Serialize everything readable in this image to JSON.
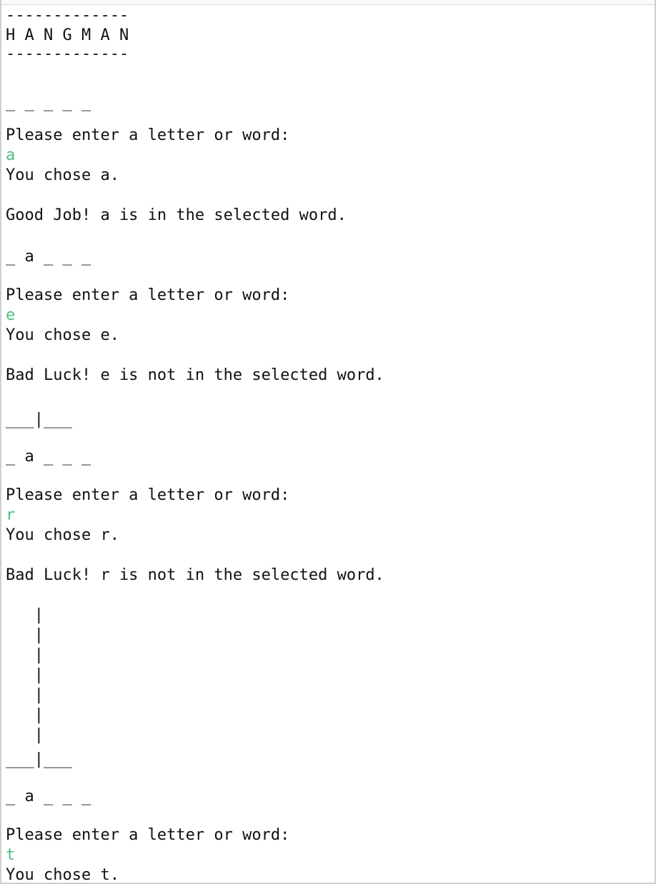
{
  "colors": {
    "text": "#111111",
    "input_echo": "#4fbf7f",
    "background": "#ffffff",
    "frame": "#cfcfcf"
  },
  "console": {
    "lines": [
      {
        "kind": "rule",
        "text": "-------------"
      },
      {
        "kind": "title",
        "text": "H A N G M A N"
      },
      {
        "kind": "rule",
        "text": "-------------"
      },
      {
        "kind": "blanks",
        "text": "_ _ _ _ _"
      },
      {
        "kind": "prompt",
        "text": "Please enter a letter or word:"
      },
      {
        "kind": "input",
        "text": "a"
      },
      {
        "kind": "message",
        "text": "You chose a."
      },
      {
        "kind": "message",
        "text": "Good Job! a is in the selected word."
      },
      {
        "kind": "blanks",
        "text": "_ a _ _ _"
      },
      {
        "kind": "prompt",
        "text": "Please enter a letter or word:"
      },
      {
        "kind": "input",
        "text": "e"
      },
      {
        "kind": "message",
        "text": "You chose e."
      },
      {
        "kind": "message",
        "text": "Bad Luck! e is not in the selected word."
      },
      {
        "kind": "art",
        "text": "___|___"
      },
      {
        "kind": "blanks",
        "text": "_ a _ _ _"
      },
      {
        "kind": "prompt",
        "text": "Please enter a letter or word:"
      },
      {
        "kind": "input",
        "text": "r"
      },
      {
        "kind": "message",
        "text": "You chose r."
      },
      {
        "kind": "message",
        "text": "Bad Luck! r is not in the selected word."
      },
      {
        "kind": "art",
        "text": "   |"
      },
      {
        "kind": "art",
        "text": "   |"
      },
      {
        "kind": "art",
        "text": "   |"
      },
      {
        "kind": "art",
        "text": "   |"
      },
      {
        "kind": "art",
        "text": "   |"
      },
      {
        "kind": "art",
        "text": "   |"
      },
      {
        "kind": "art",
        "text": "   |"
      },
      {
        "kind": "art",
        "text": "___|___"
      },
      {
        "kind": "blanks",
        "text": "_ a _ _ _"
      },
      {
        "kind": "prompt",
        "text": "Please enter a letter or word:"
      },
      {
        "kind": "input",
        "text": "t"
      },
      {
        "kind": "message",
        "text": "You chose t."
      }
    ]
  }
}
